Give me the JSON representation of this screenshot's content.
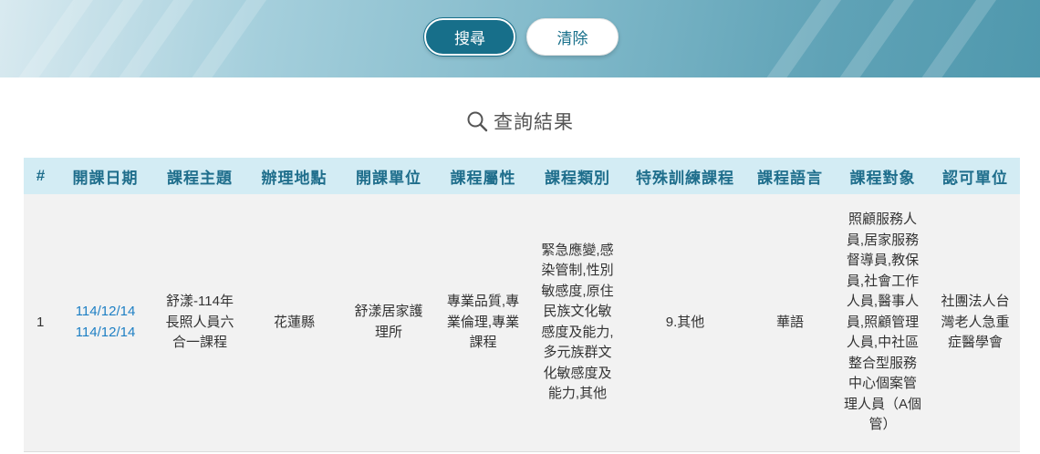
{
  "toolbar": {
    "search_label": "搜尋",
    "clear_label": "清除"
  },
  "results": {
    "title": "查詢結果",
    "search_icon": "magnifier-icon"
  },
  "table": {
    "headers": [
      "#",
      "開課日期",
      "課程主題",
      "辦理地點",
      "開課單位",
      "課程屬性",
      "課程類別",
      "特殊訓練課程",
      "課程語言",
      "課程對象",
      "認可單位"
    ],
    "rows": [
      {
        "index": "1",
        "start_date": "114/12/14",
        "end_date": "114/12/14",
        "topic": "舒漾-114年長照人員六合一課程",
        "location": "花蓮縣",
        "organizer": "舒漾居家護理所",
        "attribute": "專業品質,專業倫理,專業課程",
        "category": "緊急應變,感染管制,性別敏感度,原住民族文化敏感度及能力,多元族群文化敏感度及能力,其他",
        "special_training": "9.其他",
        "language": "華語",
        "audience": "照顧服務人員,居家服務督導員,教保員,社會工作人員,醫事人員,照顧管理人員,中社區整合型服務中心個案管理人員（A個管）",
        "accreditor": "社團法人台灣老人急重症醫學會"
      }
    ]
  },
  "colors": {
    "primary": "#176f8a",
    "header_bg": "#d3ecf4",
    "header_text": "#1f6e8c",
    "link": "#1d7fc4",
    "row_bg": "#f2f2f2"
  }
}
